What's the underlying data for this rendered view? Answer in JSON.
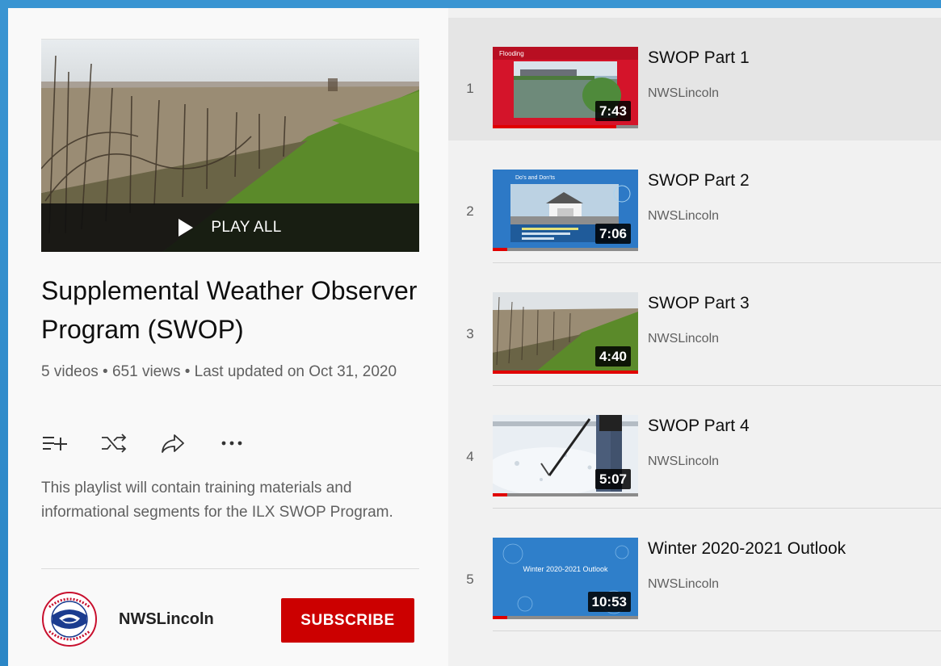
{
  "playlist": {
    "play_all_label": "PLAY ALL",
    "title": "Supplemental Weather Observer Program (SWOP)",
    "meta": "5 videos • 651 views • Last updated on Oct 31, 2020",
    "description": "This playlist will contain training materials and informational segments for the ILX SWOP Program.",
    "actions": [
      "save-to-library-icon",
      "shuffle-icon",
      "share-icon",
      "more-icon"
    ]
  },
  "owner": {
    "name": "NWSLincoln",
    "subscribe_label": "SUBSCRIBE",
    "avatar_icon": "nws-logo"
  },
  "colors": {
    "accent": "#cc0000",
    "selected_row": "#e5e5e5",
    "list_bg": "#f1f1f1",
    "panel_bg": "#f9f9f9"
  },
  "videos": [
    {
      "index": "1",
      "title": "SWOP Part 1",
      "channel": "NWSLincoln",
      "duration": "7:43",
      "progress": 0.85,
      "thumb_caption": "Flooding"
    },
    {
      "index": "2",
      "title": "SWOP Part 2",
      "channel": "NWSLincoln",
      "duration": "7:06",
      "progress": 0.1,
      "thumb_caption": "Do's and Don'ts"
    },
    {
      "index": "3",
      "title": "SWOP Part 3",
      "channel": "NWSLincoln",
      "duration": "4:40",
      "progress": 1.0,
      "thumb_caption": ""
    },
    {
      "index": "4",
      "title": "SWOP Part 4",
      "channel": "NWSLincoln",
      "duration": "5:07",
      "progress": 0.1,
      "thumb_caption": ""
    },
    {
      "index": "5",
      "title": "Winter 2020-2021 Outlook",
      "channel": "NWSLincoln",
      "duration": "10:53",
      "progress": 0.1,
      "thumb_caption": "Winter 2020-2021 Outlook"
    }
  ]
}
